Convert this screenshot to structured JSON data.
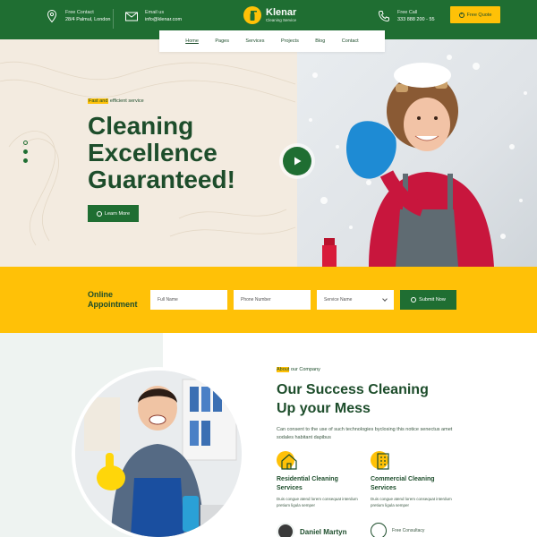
{
  "topbar": {
    "contact": {
      "label": "Free Contact",
      "value": "28/4 Palmul, London"
    },
    "email": {
      "label": "Email us",
      "value": "info@klenar.com"
    },
    "call": {
      "label": "Free Call",
      "value": "333 888 200 - 55"
    },
    "logo": {
      "name": "Klenar",
      "tagline": "Cleaning Service"
    },
    "quote_label": "Free Quote"
  },
  "nav": {
    "items": [
      "Home",
      "Pages",
      "Services",
      "Projects",
      "Blog",
      "Contact"
    ]
  },
  "hero": {
    "tag_highlight": "Fast and",
    "tag_rest": " efficient service",
    "title_line1": "Cleaning",
    "title_line2": "Excellence",
    "title_line3": "Guaranteed!",
    "button_label": "Learn More"
  },
  "appointment": {
    "title_line1": "Online",
    "title_line2": "Appointment",
    "full_name_placeholder": "Full Name",
    "phone_placeholder": "Phone Number",
    "service_placeholder": "Service Name",
    "submit_label": "Submit Now"
  },
  "about": {
    "tag_highlight": "About",
    "tag_rest": " our Company",
    "title_line1": "Our Success Cleaning",
    "title_line2": "Up your Mess",
    "description": "Can consent to the use of such technologies byclosing this notice senectus amet sodales habitant dapibus",
    "services": [
      {
        "title_line1": "Residential Cleaning",
        "title_line2": "Services",
        "desc": "Duis congue atend lorem consequat interdum pretium ligula semper"
      },
      {
        "title_line1": "Commercial Cleaning",
        "title_line2": "Services",
        "desc": "Duis congue atend lorem consequat interdum pretium ligula semper"
      }
    ],
    "person_name": "Daniel Martyn",
    "contact_label": "Free Consultacy"
  },
  "colors": {
    "green": "#1f6e32",
    "yellow": "#ffc107",
    "dark_text": "#1d4d2b",
    "cream": "#f3ebe0"
  }
}
